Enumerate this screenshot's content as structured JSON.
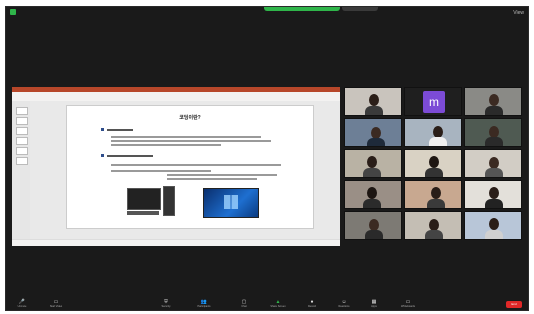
{
  "topbar": {
    "view_label": "View"
  },
  "slide": {
    "title": "코딩이란?"
  },
  "gallery": {
    "avatar_letter": "m"
  },
  "toolbar": {
    "items": [
      {
        "icon": "microphone-icon",
        "label": "Unmute"
      },
      {
        "icon": "video-camera-icon",
        "label": "Start Video"
      },
      {
        "icon": "security-icon",
        "label": "Security"
      },
      {
        "icon": "participants-icon",
        "label": "Participants"
      },
      {
        "icon": "chat-icon",
        "label": "Chat"
      },
      {
        "icon": "share-screen-icon",
        "label": "Share Screen"
      },
      {
        "icon": "record-icon",
        "label": "Record"
      },
      {
        "icon": "reactions-icon",
        "label": "Reactions"
      },
      {
        "icon": "apps-icon",
        "label": "Apps"
      },
      {
        "icon": "whiteboard-icon",
        "label": "Whiteboards"
      }
    ],
    "end_label": "End"
  },
  "colors": {
    "share_accent": "#2fb54a",
    "ppt_brand": "#b7472a",
    "end_red": "#e02828",
    "avatar_purple": "#7c4bd6"
  }
}
